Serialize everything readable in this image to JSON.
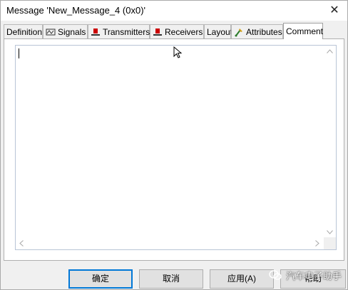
{
  "window": {
    "title": "Message 'New_Message_4 (0x0)'",
    "close_glyph": "✕"
  },
  "tabs": [
    {
      "label": "Definition",
      "icon": "",
      "active": false
    },
    {
      "label": "Signals",
      "icon": "signals-icon",
      "active": false
    },
    {
      "label": "Transmitters",
      "icon": "transmitter-node-icon",
      "active": false
    },
    {
      "label": "Receivers",
      "icon": "receiver-node-icon",
      "active": false
    },
    {
      "label": "Layout",
      "icon": "",
      "active": false
    },
    {
      "label": "Attributes",
      "icon": "attributes-icon",
      "active": false
    },
    {
      "label": "Comment",
      "icon": "",
      "active": true
    }
  ],
  "comment": {
    "value": ""
  },
  "buttons": {
    "ok": "确定",
    "cancel": "取消",
    "apply": "应用(A)",
    "help": "帮助"
  },
  "watermark": {
    "text": "汽车电子助手"
  },
  "colors": {
    "accent": "#0078d7",
    "node_red": "#cc0000"
  }
}
